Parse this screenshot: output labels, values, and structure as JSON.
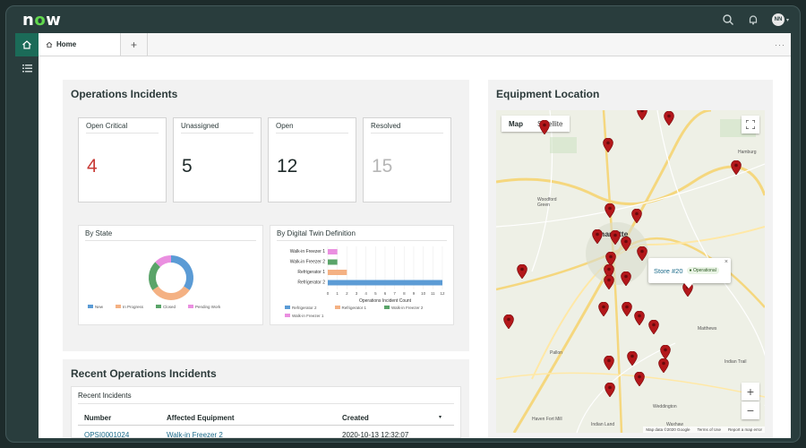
{
  "app": {
    "logo_prefix": "n",
    "logo_o": "o",
    "logo_suffix": "w",
    "avatar_initials": "NN"
  },
  "tabs": {
    "home_label": "Home",
    "add_label": "+",
    "more_label": "···"
  },
  "operations": {
    "title": "Operations Incidents",
    "cards": [
      {
        "label": "Open Critical",
        "value": "4",
        "color": "#c83a36"
      },
      {
        "label": "Unassigned",
        "value": "5",
        "color": "#1f2a2a"
      },
      {
        "label": "Open",
        "value": "12",
        "color": "#1f2a2a"
      },
      {
        "label": "Resolved",
        "value": "15",
        "color": "#b6b6b6"
      }
    ],
    "by_state": {
      "title": "By State",
      "legend": [
        "New",
        "In Progress",
        "Closed",
        "Pending Work"
      ],
      "colors": [
        "#5b9bd5",
        "#f4b183",
        "#5aa469",
        "#ea8fe0"
      ]
    },
    "by_twin": {
      "title": "By Digital Twin Definition",
      "xlabel": "Operations Incident Count",
      "legend": [
        "Refrigerator 2",
        "Refrigerator 1",
        "Walk-in Freezer 2",
        "Walk-in Freezer 1"
      ]
    }
  },
  "chart_data": [
    {
      "type": "pie",
      "title": "By State",
      "categories": [
        "New",
        "In Progress",
        "Closed",
        "Pending Work"
      ],
      "values": [
        11,
        10,
        7,
        4
      ],
      "colors": [
        "#5b9bd5",
        "#f4b183",
        "#5aa469",
        "#ea8fe0"
      ]
    },
    {
      "type": "bar",
      "title": "By Digital Twin Definition",
      "orientation": "horizontal",
      "categories": [
        "Walk-in Freezer 1",
        "Walk-in Freezer 2",
        "Refrigerator 1",
        "Refrigerator 2"
      ],
      "values": [
        1,
        1,
        2,
        12
      ],
      "colors": [
        "#ea8fe0",
        "#5aa469",
        "#f4b183",
        "#5b9bd5"
      ],
      "xlabel": "Operations Incident Count",
      "x_ticks": [
        "0",
        "1",
        "2",
        "3",
        "4",
        "5",
        "6",
        "7",
        "8",
        "9",
        "10",
        "11",
        "12"
      ],
      "xlim": [
        0,
        12
      ]
    }
  ],
  "recent": {
    "title": "Recent Operations Incidents",
    "subtitle": "Recent Incidents",
    "columns": [
      "Number",
      "Affected Equipment",
      "Created"
    ],
    "rows": [
      {
        "number": "OPSI0001024",
        "equipment": "Walk-in Freezer 2",
        "created": "2020-10-13 12:32:07"
      }
    ]
  },
  "map": {
    "title": "Equipment Location",
    "map_label": "Map",
    "satellite_label": "Satellite",
    "city": "Charlotte",
    "places": [
      "Woodford Green",
      "Hamburg",
      "Matthews",
      "Indian Trail",
      "Weddington",
      "Indian Land",
      "Haven Fort Mill",
      "Waxhaw",
      "Pallon"
    ],
    "info_store": "Store #20",
    "info_status": "Operational",
    "attribution": [
      "Map data ©2020 Google",
      "Terms of Use",
      "Report a map error"
    ],
    "zoom_in": "+",
    "zoom_out": "−",
    "marker_color": "#b3171a"
  }
}
